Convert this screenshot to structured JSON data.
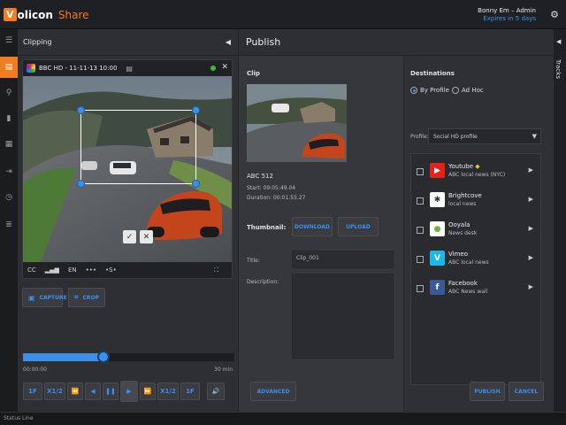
{
  "header": {
    "logo_v": "V",
    "logo_word": "olicon",
    "logo_share": "Share",
    "user_name": "Bonny Em – Admin",
    "expires": "Expires in 5 days"
  },
  "rail": {
    "items": [
      "menu-icon",
      "clipping-icon",
      "search-icon",
      "bookmark-icon",
      "calendar-icon",
      "export-icon",
      "clock-icon",
      "list-icon"
    ],
    "active": "clipping-icon"
  },
  "clipping": {
    "title": "Clipping",
    "player": {
      "channel": "BBC HD - 11-11-13 10:00",
      "controls": [
        "CC",
        "EN",
        "•••",
        "•S•"
      ],
      "confirm": "✓",
      "cancel": "✕"
    },
    "capture_label": "CAPTURE",
    "crop_label": "CROP",
    "timeline": {
      "start": "00:00:00",
      "end": "30 min",
      "position": 0.38
    },
    "transport": [
      "1F",
      "X1/2",
      "⏪",
      "◀",
      "❚❚",
      "▶",
      "⏩",
      "X1/2",
      "1F"
    ]
  },
  "publish": {
    "title": "Publish",
    "clip_heading": "Clip",
    "clip_name": "ABC 512",
    "start": "Start: 09:05:49.04",
    "duration": "Duration: 00:01:55.27",
    "thumbnail_label": "Thumbnail:",
    "download_label": "DOWNLOAD",
    "upload_label": "UPLOAD",
    "title_label": "Title:",
    "title_value": "Clip_001",
    "description_label": "Description:",
    "advanced_label": "ADVANCED",
    "destinations_heading": "Destinations",
    "by_profile": "By Profile",
    "ad_hoc": "Ad Hoc",
    "profile_label": "Profile:",
    "profile_value": "Social HD profile",
    "destinations": [
      {
        "name": "Youtube",
        "sub": "ABC local news (NYC)",
        "color": "#e62117",
        "glyph": "▶"
      },
      {
        "name": "Brightcove",
        "sub": "local news",
        "color": "#ffffff",
        "glyph": "✱"
      },
      {
        "name": "Ooyala",
        "sub": "News desk",
        "color": "#ffffff",
        "glyph": "●"
      },
      {
        "name": "Vimeo",
        "sub": "ABC local news",
        "color": "#1ab7ea",
        "glyph": "V"
      },
      {
        "name": "Facebook",
        "sub": "ABC News wall",
        "color": "#3b5998",
        "glyph": "f"
      }
    ],
    "publish_label": "PUBLISH",
    "cancel_label": "CANCEL"
  },
  "tracks_label": "Tracks",
  "status_line": "Status Line",
  "colors": {
    "accent": "#f07d1f",
    "blue": "#3d8fe8"
  }
}
